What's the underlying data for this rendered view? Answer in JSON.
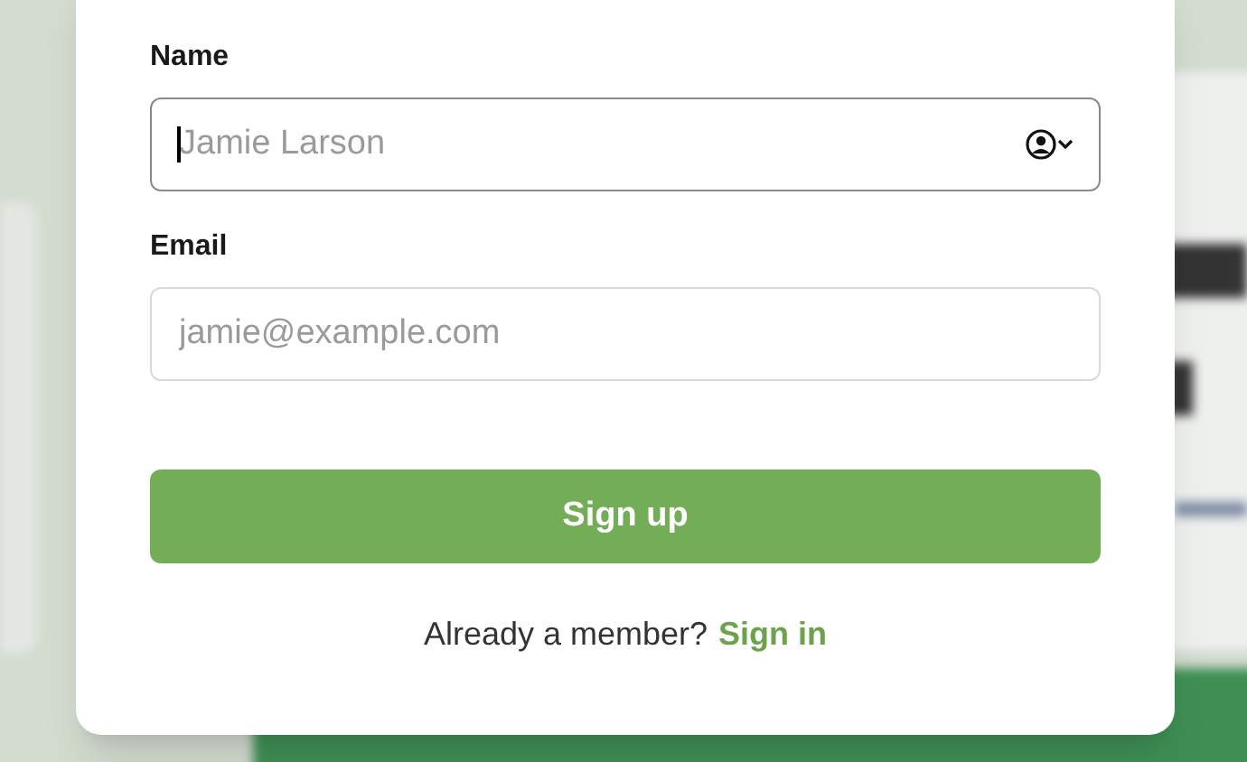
{
  "form": {
    "fields": [
      {
        "label": "Name",
        "placeholder": "Jamie Larson",
        "focused": true,
        "autofill_icon": true
      },
      {
        "label": "Email",
        "placeholder": "jamie@example.com",
        "focused": false,
        "autofill_icon": false
      }
    ],
    "submit": "Sign up",
    "footer": {
      "text": "Already a member?",
      "link": "Sign in"
    }
  }
}
